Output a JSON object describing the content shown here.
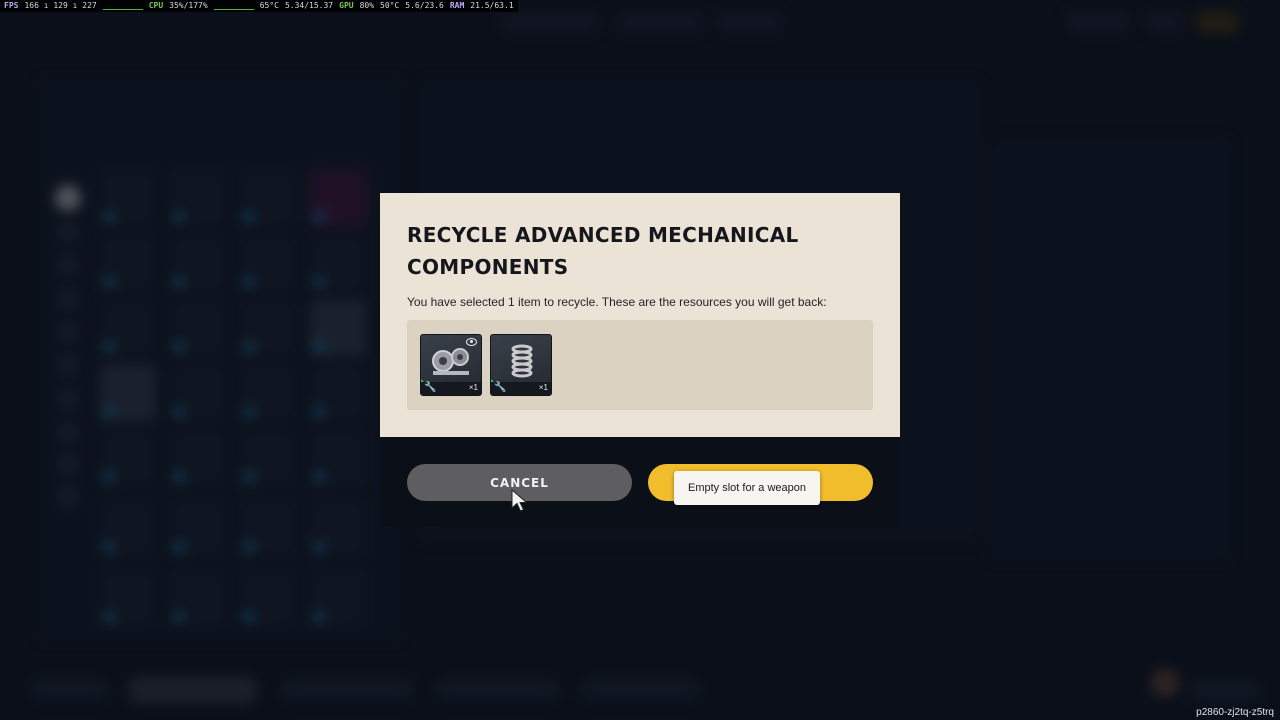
{
  "perf_overlay": {
    "fps_label": "FPS",
    "fps_value": "166 ı 129 ı 227",
    "cpu_label": "CPU",
    "cpu_value": "35%/177%",
    "cpu_temp": "65°C",
    "cpu_clock": "5.34/15.37",
    "gpu_label": "GPU",
    "gpu_value": "80%",
    "gpu_temp": "50°C",
    "vram": "5.6/23.6",
    "ram_label": "RAM",
    "ram_value": "21.5/63.1"
  },
  "modal": {
    "title": "RECYCLE ADVANCED MECHANICAL COMPONENTS",
    "description": "You have selected 1 item to recycle. These are the resources you will get back:",
    "resources": [
      {
        "icon": "gears-icon",
        "quantity": "×1",
        "rarity_color": "#31c24a",
        "has_preview": true
      },
      {
        "icon": "spring-icon",
        "quantity": "×1",
        "rarity_color": "#31c24a",
        "has_preview": false
      }
    ],
    "cancel_label": "CANCEL",
    "confirm_color": "#f1bd2c"
  },
  "tooltip": {
    "text": "Empty slot for a weapon"
  },
  "build_tag": "p2860-zj2tq-z5trq"
}
